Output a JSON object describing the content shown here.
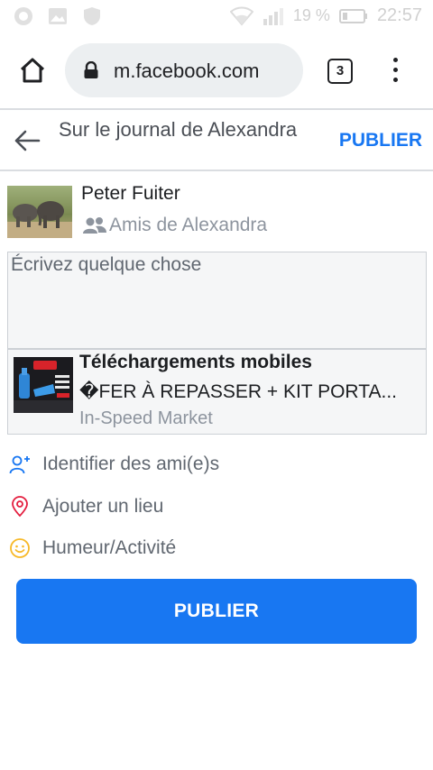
{
  "status_bar": {
    "battery_percent": "19 %",
    "time": "22:57"
  },
  "browser": {
    "url": "m.facebook.com",
    "tab_count": "3"
  },
  "composer": {
    "header_title": "Sur le journal de Alexandra",
    "publish_top_label": "PUBLIER",
    "author_name": "Peter Fuiter",
    "audience": "Amis de Alexandra",
    "placeholder": "Écrivez quelque chose",
    "link_card": {
      "title": "Téléchargements mobiles",
      "description": "�FER À REPASSER + KIT PORTA...",
      "source": "In-Speed Market"
    },
    "actions": [
      {
        "label": "Identifier des ami(e)s",
        "icon": "tag-friends-icon"
      },
      {
        "label": "Ajouter un lieu",
        "icon": "location-pin-icon"
      },
      {
        "label": "Humeur/Activité",
        "icon": "smiley-icon"
      }
    ],
    "publish_button_label": "PUBLIER"
  },
  "colors": {
    "accent": "#1877f2",
    "location": "#e41e3f",
    "feeling": "#f7b928",
    "tag": "#1877f2"
  }
}
